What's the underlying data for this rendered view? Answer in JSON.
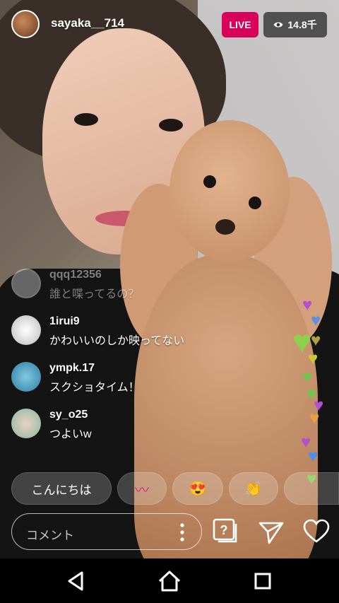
{
  "header": {
    "username": "sayaka__714",
    "live_label": "LIVE",
    "viewer_count": "14.8千"
  },
  "comments": [
    {
      "username": "qqq12356",
      "text": "誰と喋ってるの？"
    },
    {
      "username": "1irui9",
      "text": "かわいいのしか映ってない"
    },
    {
      "username": "ympk.17",
      "text": "スクショタイム！"
    },
    {
      "username": "sy_o25",
      "text": "つよいw"
    }
  ],
  "quick_replies": [
    "こんにちは",
    "〰",
    "😍",
    "👏"
  ],
  "composer": {
    "placeholder": "コメント"
  },
  "colors": {
    "live_badge": "#d8005b",
    "heart_colors": [
      "#b44fd0",
      "#4a8ef0",
      "#7fd04a",
      "#e9a23b",
      "#a2d84a"
    ]
  },
  "icons": [
    "question-card-icon",
    "send-icon",
    "heart-icon",
    "back-icon",
    "home-icon",
    "recents-icon"
  ]
}
